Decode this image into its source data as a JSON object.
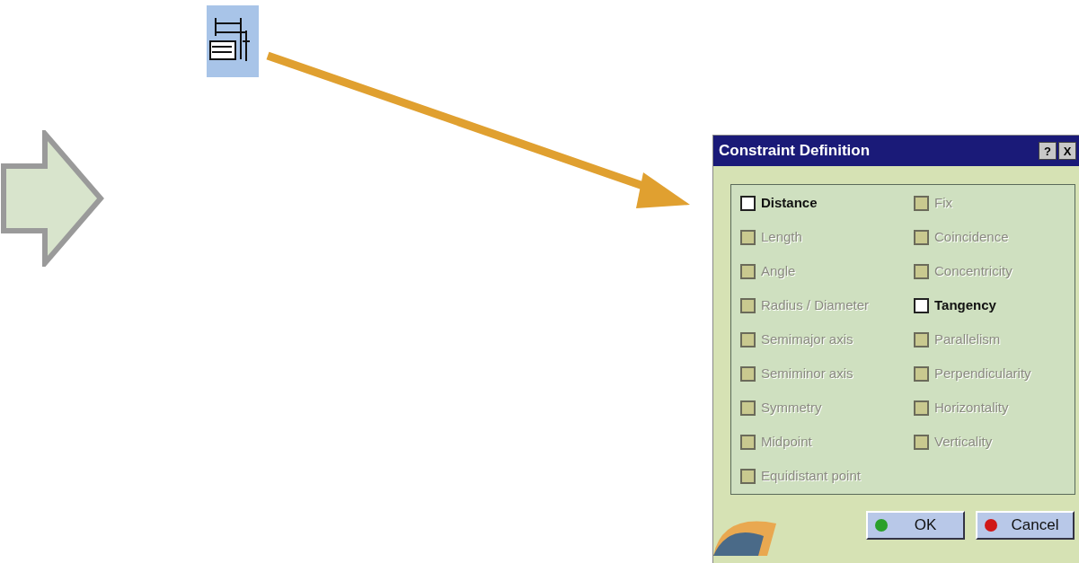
{
  "dialog": {
    "title": "Constraint Definition",
    "title_buttons": [
      "?",
      "X"
    ],
    "left_column": [
      {
        "label": "Distance",
        "checked": false,
        "disabled": false
      },
      {
        "label": "Length",
        "checked": false,
        "disabled": true
      },
      {
        "label": "Angle",
        "checked": false,
        "disabled": true
      },
      {
        "label": "Radius / Diameter",
        "checked": false,
        "disabled": true
      },
      {
        "label": "Semimajor axis",
        "checked": false,
        "disabled": true
      },
      {
        "label": "Semiminor axis",
        "checked": false,
        "disabled": true
      },
      {
        "label": "Symmetry",
        "checked": false,
        "disabled": true
      },
      {
        "label": "Midpoint",
        "checked": false,
        "disabled": true
      },
      {
        "label": "Equidistant point",
        "checked": false,
        "disabled": true
      }
    ],
    "right_column": [
      {
        "label": "Fix",
        "checked": false,
        "disabled": true
      },
      {
        "label": "Coincidence",
        "checked": false,
        "disabled": true
      },
      {
        "label": "Concentricity",
        "checked": false,
        "disabled": true
      },
      {
        "label": "Tangency",
        "checked": false,
        "disabled": false
      },
      {
        "label": "Parallelism",
        "checked": false,
        "disabled": true
      },
      {
        "label": "Perpendicularity",
        "checked": false,
        "disabled": true
      },
      {
        "label": "Horizontality",
        "checked": false,
        "disabled": true
      },
      {
        "label": "Verticality",
        "checked": false,
        "disabled": true
      }
    ],
    "buttons": [
      {
        "label": "OK",
        "kind": "ok"
      },
      {
        "label": "Cancel",
        "kind": "cancel"
      }
    ]
  }
}
